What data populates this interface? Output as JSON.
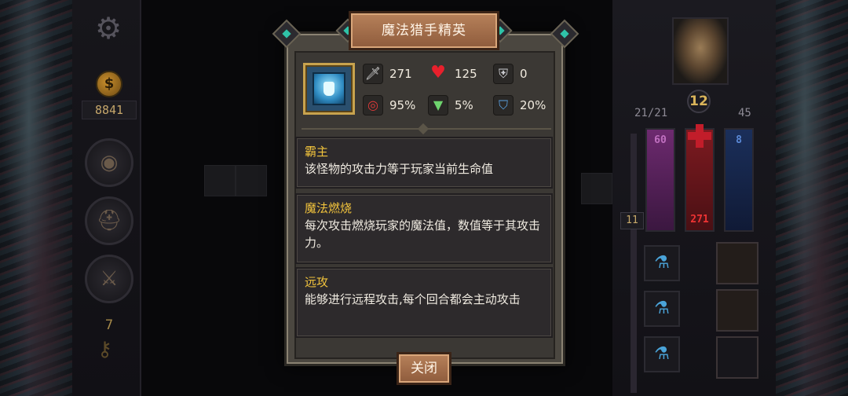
{
  "hud": {
    "gold": "8841",
    "key_count": "7",
    "hp_ratio": "21/21",
    "armor": "45",
    "level": "12",
    "mana_top": "60",
    "red_bottom": "271",
    "blue_top": "8",
    "side_value": "11"
  },
  "modal": {
    "title": "魔法猎手精英",
    "stats": {
      "attack": "271",
      "health": "125",
      "armor": "0",
      "accuracy": "95%",
      "dodge": "5%",
      "resist": "20%"
    },
    "abilities": [
      {
        "name": "霸主",
        "desc": "该怪物的攻击力等于玩家当前生命值"
      },
      {
        "name": "魔法燃烧",
        "desc": "每次攻击燃烧玩家的魔法值，数值等于其攻击力。"
      },
      {
        "name": "远攻",
        "desc": "能够进行远程攻击,每个回合都会主动攻击"
      }
    ],
    "close_label": "关闭"
  }
}
